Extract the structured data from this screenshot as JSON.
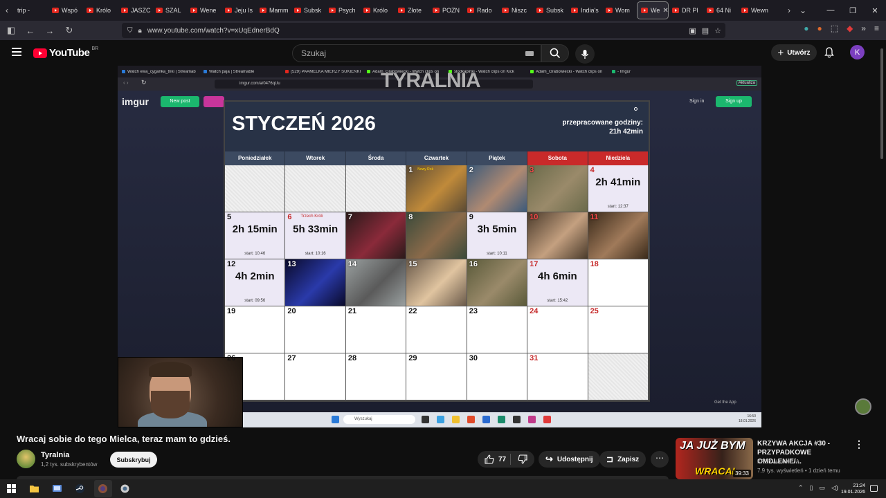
{
  "browser": {
    "tabs": [
      "trip - ",
      "Wspó",
      "Królo",
      "JASZC",
      "SZAL",
      "Wene",
      "Jeju Is",
      "Mamm",
      "Subsk",
      "Psych",
      "Królo",
      "Złote",
      "POZN",
      "Rado",
      "Niszc",
      "Subsk",
      "India's",
      "Wom",
      "We",
      "DR Pl",
      "64 Ni",
      "Wewn"
    ],
    "active_tab_index": 18,
    "url": "www.youtube.com/watch?v=xUqEdnerBdQ"
  },
  "youtube": {
    "logo_text": "YouTube",
    "country": "BR",
    "search_placeholder": "Szukaj",
    "create_label": "Utwórz",
    "avatar_letter": "K"
  },
  "stream_browser": {
    "tabs": [
      "Watch ewa_cyganka_triki | Streamab",
      "Watch paja | Streamable",
      "(529) PAAMELKA MIERZY SUKIENKI",
      "Adam_Grabowiecki - Watch clips on",
      "slodkapinki - Watch clips on Kick",
      "Adam_Grabowiecki - Watch clips on",
      "- Imgur"
    ],
    "url": "imgur.com/a/0476qUu",
    "overlay_text": "TYRALNIA",
    "imgur_logo": "imgur",
    "new_post": "New post",
    "sign_in": "Sign in",
    "sign_up": "Sign up",
    "get_app": "Get the App",
    "update_label": "Aktualiza",
    "search_label": "Wyszukaj",
    "clock_time": "16:50",
    "clock_date": "18.01.2026"
  },
  "calendar": {
    "title": "STYCZEŃ 2026",
    "hours_label": "przepracowane godziny:",
    "hours_value": "21h 42min",
    "days": [
      "Poniedziałek",
      "Wtorek",
      "Środa",
      "Czwartek",
      "Piątek",
      "Sobota",
      "Niedziela"
    ],
    "cells": [
      {
        "kind": "empty"
      },
      {
        "kind": "empty"
      },
      {
        "kind": "empty"
      },
      {
        "day": "1",
        "kind": "photo",
        "tag": "Nowy Rok",
        "c1": "#5a4a34",
        "c2": "#c08a3a"
      },
      {
        "day": "2",
        "kind": "photo",
        "c1": "#3c5a7a",
        "c2": "#b08a72"
      },
      {
        "day": "3",
        "kind": "photo",
        "red": true,
        "c1": "#6a6a4a",
        "c2": "#9a8a6a"
      },
      {
        "day": "4",
        "kind": "stream",
        "red": true,
        "duration": "2h 41min",
        "start": "start: 12:37"
      },
      {
        "day": "5",
        "kind": "stream",
        "duration": "2h 15min",
        "start": "start: 10:46"
      },
      {
        "day": "6",
        "kind": "stream",
        "red": true,
        "note": "Trzech Króli",
        "duration": "5h 33min",
        "start": "start: 10:16"
      },
      {
        "day": "7",
        "kind": "photo",
        "c1": "#2a1a1a",
        "c2": "#8a2a3a"
      },
      {
        "day": "8",
        "kind": "photo",
        "c1": "#3a4a3a",
        "c2": "#8a6a4a"
      },
      {
        "day": "9",
        "kind": "stream",
        "duration": "3h 5min",
        "start": "start: 10:11"
      },
      {
        "day": "10",
        "kind": "photo",
        "red": true,
        "c1": "#4a3a2a",
        "c2": "#c4a080"
      },
      {
        "day": "11",
        "kind": "photo",
        "red": true,
        "c1": "#3a2a1a",
        "c2": "#a07a5a"
      },
      {
        "day": "12",
        "kind": "stream",
        "duration": "4h 2min",
        "start": "start: 09:56"
      },
      {
        "day": "13",
        "kind": "photo",
        "c1": "#0a0a2a",
        "c2": "#2a3aaa"
      },
      {
        "day": "14",
        "kind": "photo",
        "c1": "#9aa0a0",
        "c2": "#5a5a5a"
      },
      {
        "day": "15",
        "kind": "photo",
        "c1": "#6a5a4a",
        "c2": "#e0c4a0"
      },
      {
        "day": "16",
        "kind": "photo",
        "c1": "#5a5a3a",
        "c2": "#9a8a6a"
      },
      {
        "day": "17",
        "kind": "stream",
        "red": true,
        "duration": "4h 6min",
        "start": "start: 15:42"
      },
      {
        "day": "18",
        "kind": "plain",
        "red": true
      },
      {
        "day": "19",
        "kind": "plain"
      },
      {
        "day": "20",
        "kind": "plain"
      },
      {
        "day": "21",
        "kind": "plain"
      },
      {
        "day": "22",
        "kind": "plain"
      },
      {
        "day": "23",
        "kind": "plain"
      },
      {
        "day": "24",
        "kind": "plain",
        "red": true
      },
      {
        "day": "25",
        "kind": "plain",
        "red": true
      },
      {
        "day": "26",
        "kind": "plain"
      },
      {
        "day": "27",
        "kind": "plain"
      },
      {
        "day": "28",
        "kind": "plain"
      },
      {
        "day": "29",
        "kind": "plain"
      },
      {
        "day": "30",
        "kind": "plain"
      },
      {
        "day": "31",
        "kind": "plain",
        "red": true
      },
      {
        "kind": "empty"
      }
    ]
  },
  "video": {
    "title": "Wracaj sobie do tego Mielca, teraz mam to gdzieś.",
    "channel": "Tyralnia",
    "subscribers": "1,2 tys. subskrybentów",
    "subscribe_label": "Subskrybuj",
    "likes": "77",
    "share_label": "Udostępnij",
    "save_label": "Zapisz"
  },
  "recommendation": {
    "thumb_top": "JA JUŻ BYM",
    "thumb_bottom": "WRACAŁ",
    "duration": "39:33",
    "title": "KRZYWA AKCJA #30 - PRZYPADKOWE OMDLENIE/...",
    "channel": "KRZYWA AKCJA",
    "meta": "7,9 tys. wyświetleń • 1 dzień temu"
  },
  "taskbar": {
    "time": "21:24",
    "date": "19.01.2026"
  }
}
